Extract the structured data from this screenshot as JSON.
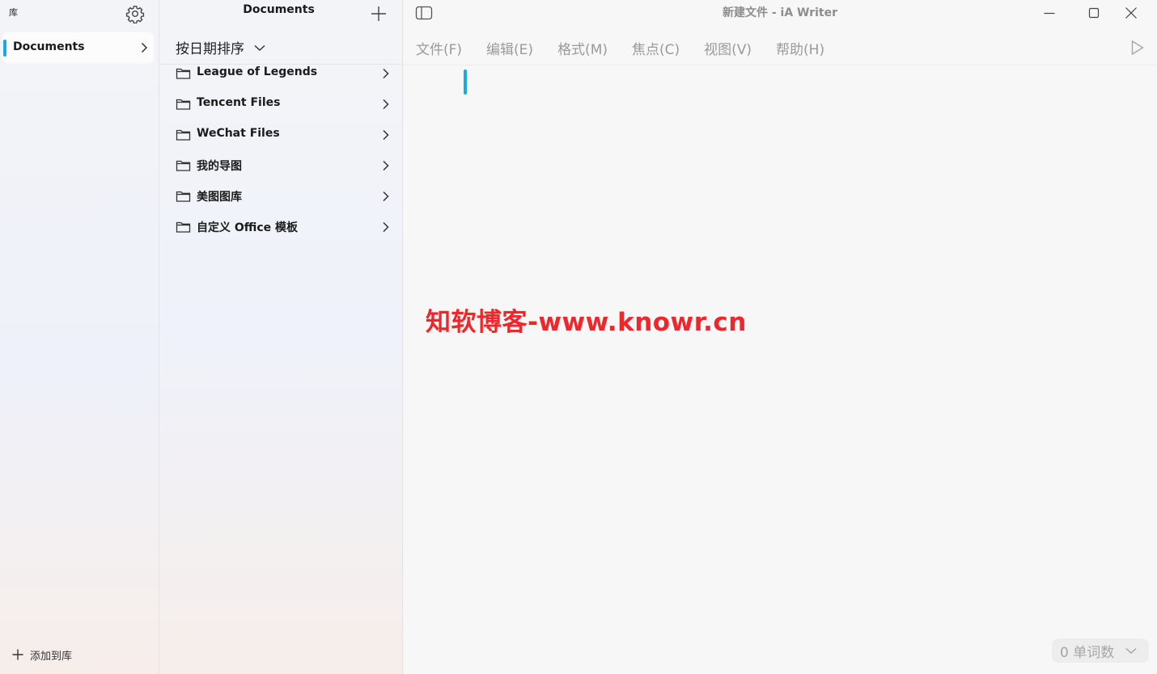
{
  "library": {
    "title": "库",
    "items": [
      {
        "label": "Documents",
        "selected": true
      }
    ],
    "add_label": "添加到库",
    "accent": "#1aa9e6"
  },
  "list": {
    "title": "Documents",
    "sort_label": "按日期排序",
    "folders": [
      {
        "name": "League of Legends"
      },
      {
        "name": "Tencent Files"
      },
      {
        "name": "WeChat Files"
      },
      {
        "name": "我的导图"
      },
      {
        "name": "美图图库"
      },
      {
        "name": "自定义 Office 模板"
      }
    ]
  },
  "window": {
    "title": "新建文件 - iA Writer"
  },
  "menu": [
    "文件(F)",
    "编辑(E)",
    "格式(M)",
    "焦点(C)",
    "视图(V)",
    "帮助(H)"
  ],
  "watermark": "知软博客-www.knowr.cn",
  "status": {
    "word_count": "0 单词数"
  },
  "icons": {
    "settings": "gear-icon",
    "add": "plus-icon",
    "folder": "folder-icon",
    "chevron": "chevron-right-icon",
    "sidebar": "sidebar-toggle-icon",
    "preview": "play-icon"
  }
}
